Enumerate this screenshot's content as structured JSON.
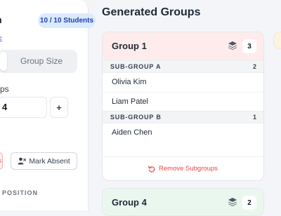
{
  "sidebar": {
    "title": "n",
    "students_badge": "10 / 10 Students",
    "section_label": "E",
    "mode_options": [
      "",
      "Group Size"
    ],
    "field_label": "ps",
    "stepper_value": "4",
    "stepper_plus": "+",
    "red_button_label": "s",
    "mark_absent_label": "Mark Absent",
    "section_label_2": "POSITION"
  },
  "main": {
    "title": "Generated Groups",
    "groups": [
      {
        "title": "Group 1",
        "count": "3",
        "subgroups": [
          {
            "label": "SUB-GROUP A",
            "count": "2",
            "members": [
              "Olivia Kim",
              "Liam Patel"
            ]
          },
          {
            "label": "SUB-GROUP B",
            "count": "1",
            "members": [
              "Aiden Chen"
            ]
          }
        ],
        "remove_label": "Remove Subgroups"
      },
      {
        "title": "Group 4",
        "count": "2"
      }
    ]
  },
  "colors": {
    "accent_purple": "#7c3aed",
    "badge_blue_bg": "#dbeafe",
    "badge_blue_text": "#1e40af",
    "group1_header": "#fdeceb",
    "group4_header": "#eaf7ee",
    "danger": "#ef4444"
  },
  "icons": {
    "layers": "layers-icon",
    "undo": "undo-icon",
    "user_x": "user-x-icon"
  }
}
